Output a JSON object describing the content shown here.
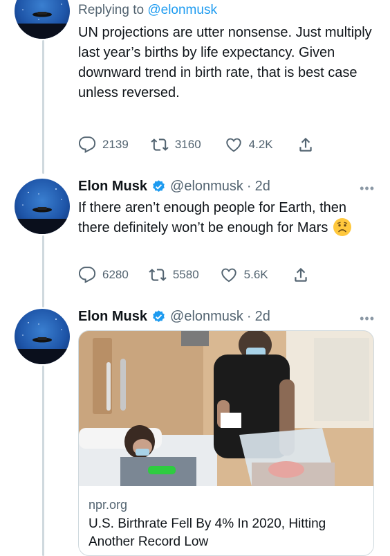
{
  "tweet1": {
    "reply_prefix": "Replying to",
    "reply_handle": "@elonmusk",
    "text": "UN projections are utter nonsense. Just multiply last year’s births by life expectancy. Given downward trend in birth rate, that is best case unless reversed.",
    "replies": "2139",
    "retweets": "3160",
    "likes": "4.2K"
  },
  "tweet2": {
    "name": "Elon Musk",
    "handle": "@elonmusk",
    "separator": "·",
    "time": "2d",
    "text": "If there aren’t enough people for Earth, then there definitely won’t be enough for Mars",
    "replies": "6280",
    "retweets": "5580",
    "likes": "5.6K"
  },
  "tweet3": {
    "name": "Elon Musk",
    "handle": "@elonmusk",
    "separator": "·",
    "time": "2d",
    "card": {
      "domain": "npr.org",
      "title": "U.S. Birthrate Fell By 4% In 2020, Hitting Another Record Low"
    }
  },
  "icons": {
    "reply": "reply-icon",
    "retweet": "retweet-icon",
    "like": "heart-icon",
    "share": "share-icon",
    "more": "more-options-icon",
    "verified": "verified-badge-icon",
    "emoji": "frowning-face-emoji"
  },
  "colors": {
    "accent": "#1d9bf0",
    "secondary_text": "#536471",
    "primary_text": "#0f1419",
    "thread_line": "#cfd9de"
  }
}
